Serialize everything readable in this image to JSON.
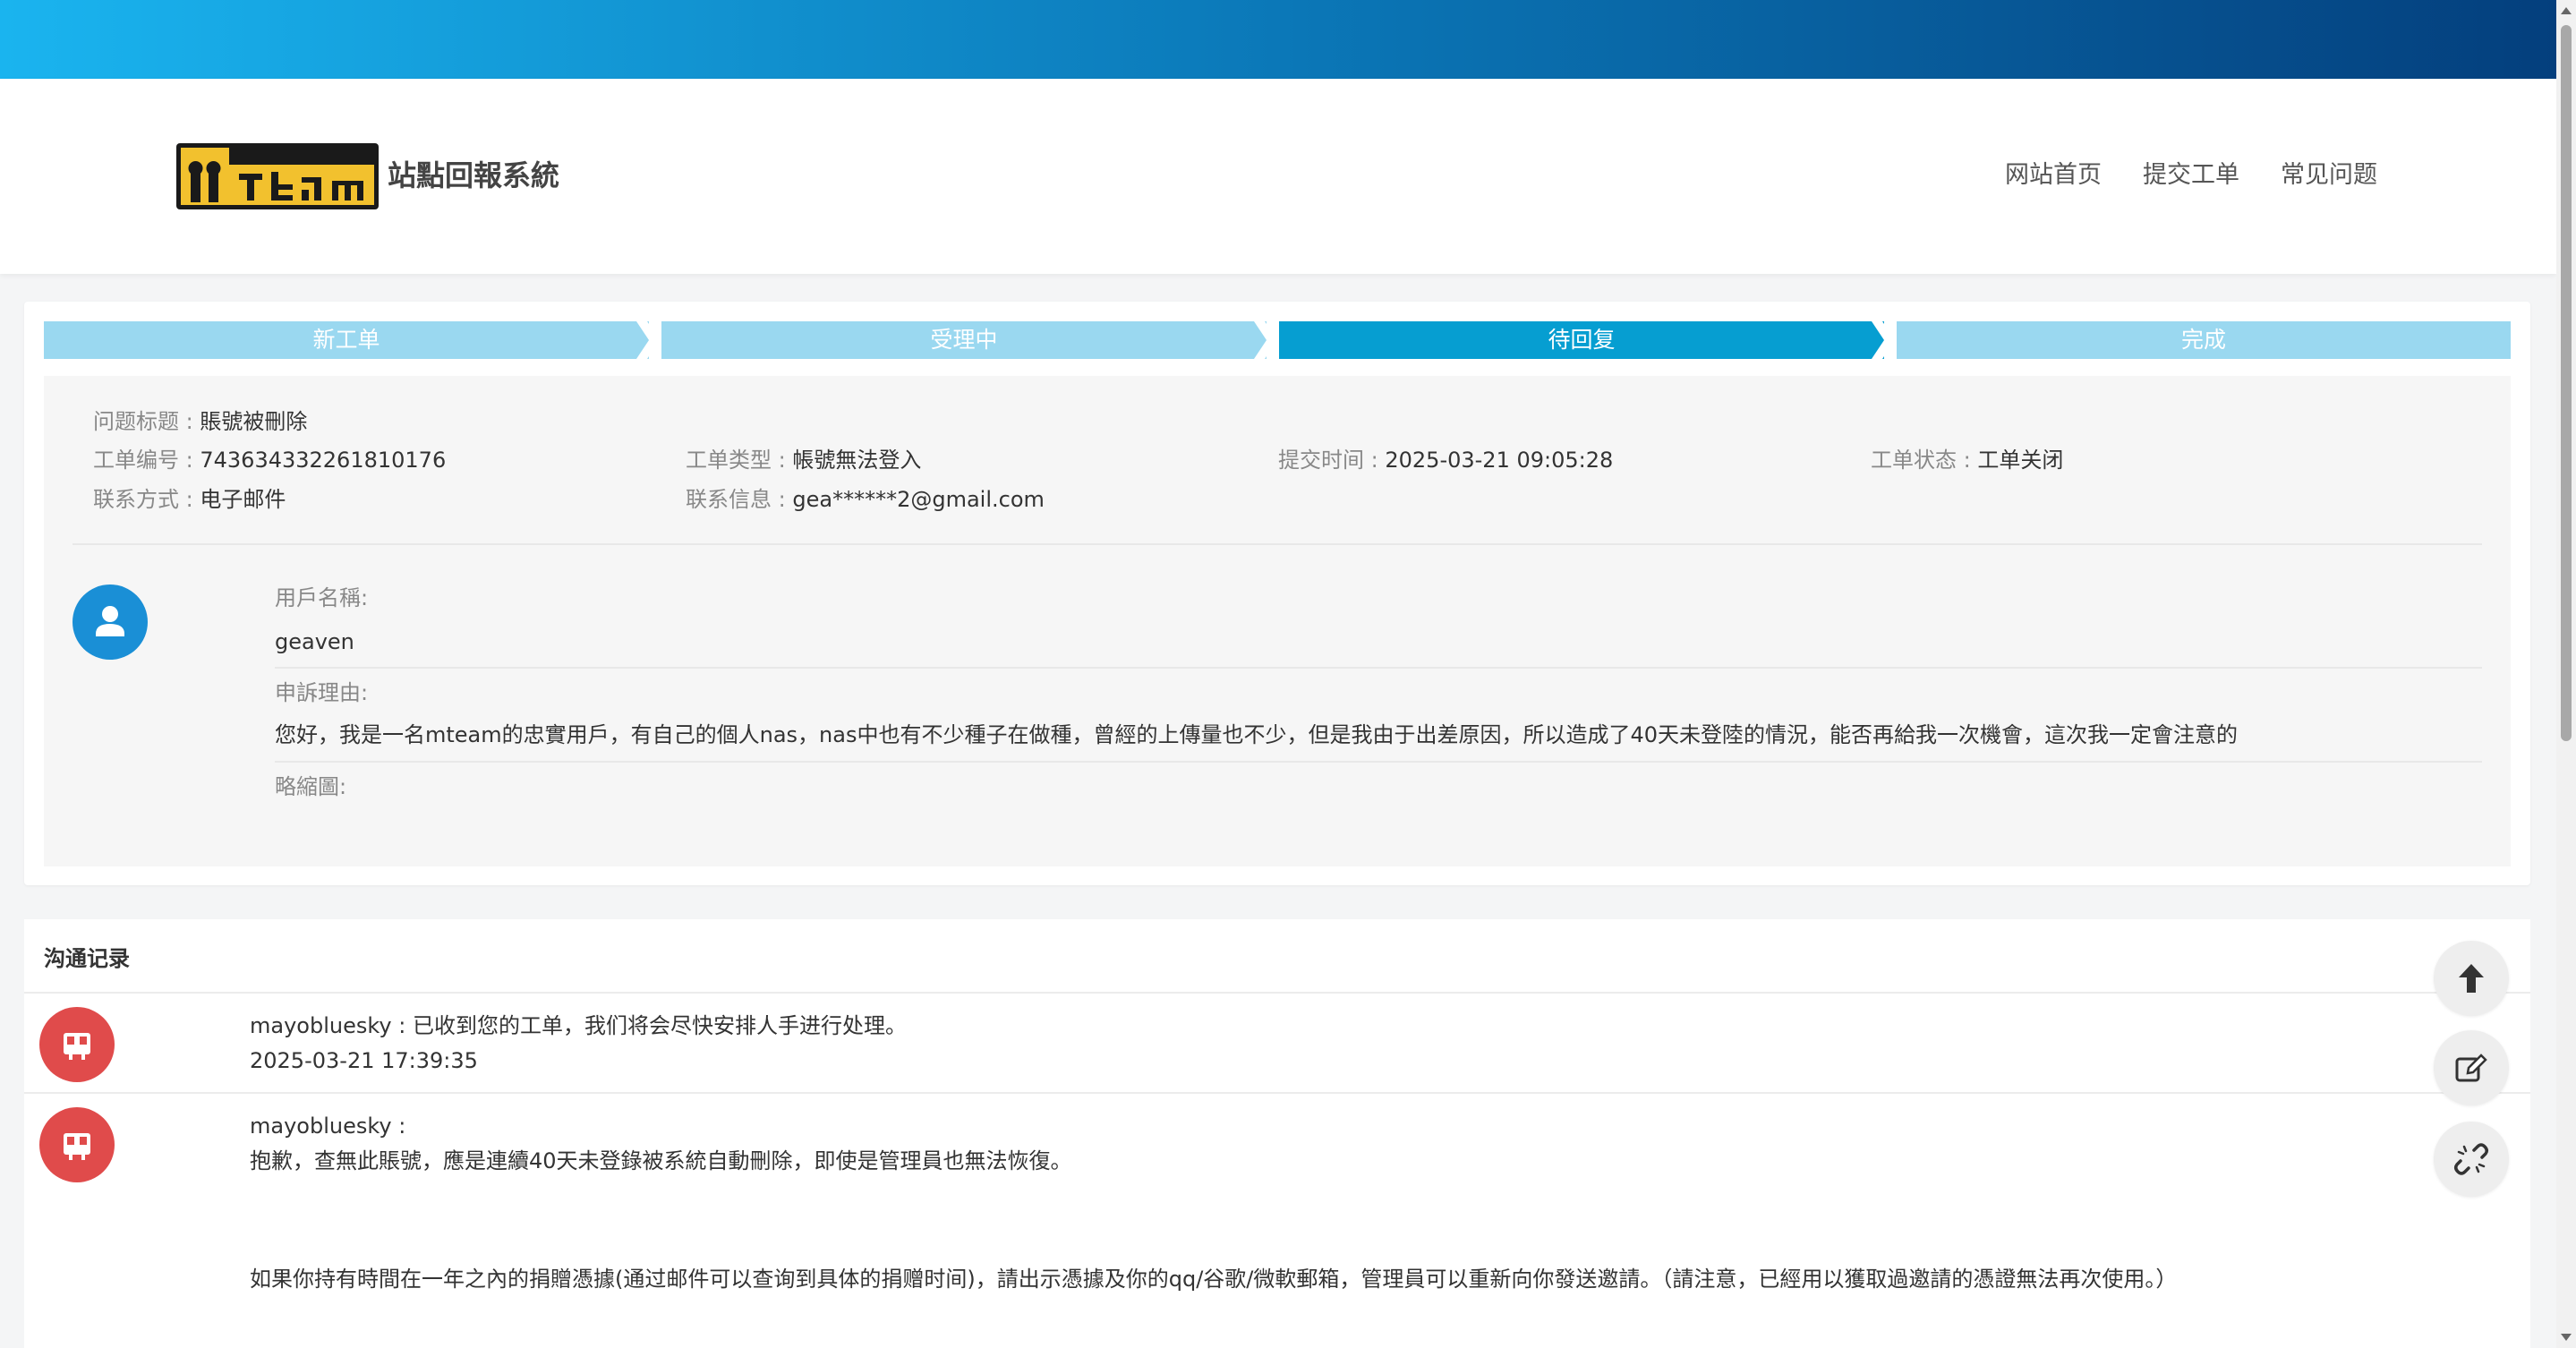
{
  "header": {
    "brand": "站點回報系統",
    "logo_text": "mteam",
    "nav": [
      "网站首页",
      "提交工单",
      "常见问题"
    ]
  },
  "steps": {
    "items": [
      "新工单",
      "受理中",
      "待回复",
      "完成"
    ],
    "active_index": 2,
    "active_color": "#069ed1",
    "inactive_color": "#9ad8f0"
  },
  "ticket": {
    "title_label": "问题标题 :",
    "title_value": "賬號被刪除",
    "id_label": "工单编号 :",
    "id_value": "743634332261810176",
    "type_label": "工单类型 :",
    "type_value": "帳號無法登入",
    "time_label": "提交时间 :",
    "time_value": "2025-03-21 09:05:28",
    "status_label": "工单状态 :",
    "status_value": "工单关闭",
    "contact_label": "联系方式 :",
    "contact_value": "电子邮件",
    "info_label": "联系信息 :",
    "info_value": "gea******2@gmail.com"
  },
  "form": {
    "username_label": "用戶名稱:",
    "username_value": "geaven",
    "reason_label": "申訴理由:",
    "reason_value": "您好，我是一名mteam的忠實用戶，有自己的個人nas，nas中也有不少種子在做種，曾經的上傳量也不少，但是我由于出差原因，所以造成了40天未登陸的情況，能否再給我一次機會，這次我一定會注意的",
    "thumb_label": "略縮圖:"
  },
  "records": {
    "title": "沟通记录",
    "items": [
      {
        "line1": "mayobluesky : 已收到您的工单，我们将会尽快安排人手进行处理。",
        "line2": "2025-03-21 17:39:35"
      },
      {
        "line1": "mayobluesky :",
        "line2": "抱歉，查無此賬號，應是連續40天未登錄被系統自動刪除，即使是管理員也無法恢復。",
        "line3": "如果你持有時間在一年之內的捐贈憑據(通过邮件可以查询到具体的捐赠时间)，請出示憑據及你的qq/谷歌/微軟郵箱，管理員可以重新向你發送邀請。（請注意，已經用以獲取過邀請的憑證無法再次使用。）"
      }
    ]
  },
  "colors": {
    "topbar_start": "#1ab4ef",
    "topbar_end": "#043f7d",
    "user_avatar": "#1a8fd6",
    "staff_avatar": "#e04b4b"
  },
  "icons": {
    "fab_top": "arrow-up-icon",
    "fab_edit": "edit-icon",
    "fab_unlink": "unlink-icon"
  }
}
